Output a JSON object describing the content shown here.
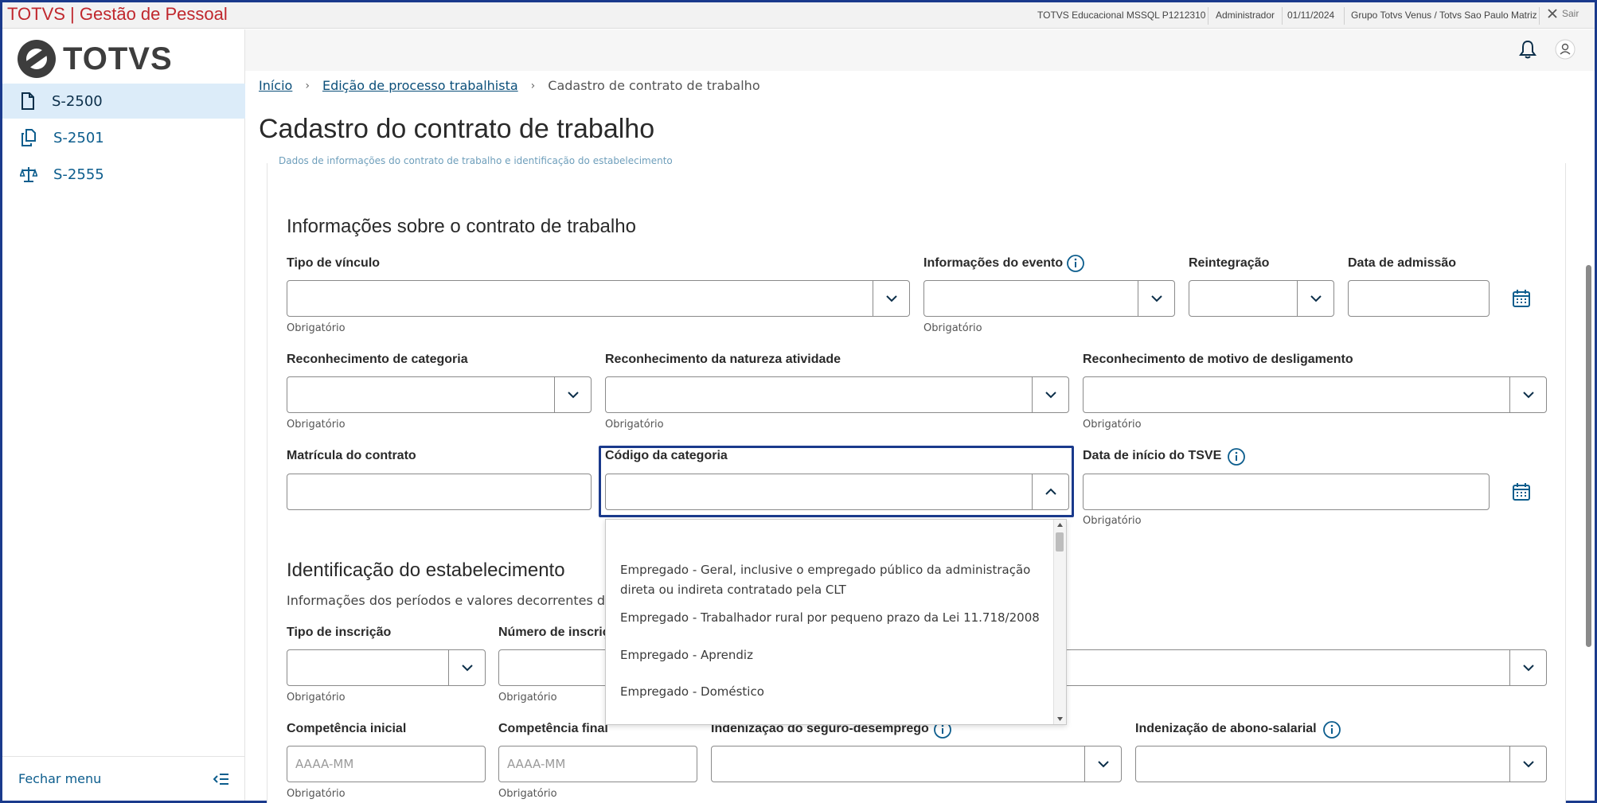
{
  "titlebar": {
    "app_title": "TOTVS | Gestão de Pessoal",
    "environment": "TOTVS Educacional MSSQL P1212310",
    "user": "Administrador",
    "date": "01/11/2024",
    "company": "Grupo Totvs Venus / Totvs Sao Paulo Matriz",
    "exit_label": "Sair"
  },
  "sidebar": {
    "logo_text": "TOTVS",
    "items": [
      {
        "label": "S-2500",
        "icon": "file-icon"
      },
      {
        "label": "S-2501",
        "icon": "copy-files-icon"
      },
      {
        "label": "S-2555",
        "icon": "scale-icon"
      }
    ],
    "close_menu": "Fechar menu"
  },
  "breadcrumb": {
    "home": "Início",
    "parent": "Edição de processo trabalhista",
    "current": "Cadastro de contrato de trabalho"
  },
  "page_title": "Cadastro do contrato de trabalho",
  "cut_text": "Dados de informações do contrato de trabalho e identificação do estabelecimento",
  "contract_section": {
    "title": "Informações sobre o contrato de trabalho",
    "tipo_vinculo": {
      "label": "Tipo de vínculo",
      "helper": "Obrigatório",
      "value": ""
    },
    "info_evento": {
      "label": "Informações do evento",
      "helper": "Obrigatório",
      "value": ""
    },
    "reintegracao": {
      "label": "Reintegração",
      "value": ""
    },
    "data_admissao": {
      "label": "Data de admissão",
      "value": ""
    },
    "rec_categoria": {
      "label": "Reconhecimento de categoria",
      "helper": "Obrigatório",
      "value": ""
    },
    "rec_natureza": {
      "label": "Reconhecimento da natureza atividade",
      "helper": "Obrigatório",
      "value": ""
    },
    "rec_motivo": {
      "label": "Reconhecimento de motivo de desligamento",
      "helper": "Obrigatório",
      "value": ""
    },
    "matricula": {
      "label": "Matrícula do contrato",
      "value": ""
    },
    "codigo_categoria": {
      "label": "Código da categoria",
      "value": ""
    },
    "data_tsve": {
      "label": "Data de início do TSVE",
      "helper": "Obrigatório",
      "value": ""
    }
  },
  "dropdown": {
    "options": [
      "Empregado - Geral, inclusive o empregado público da administração direta ou indireta contratado pela CLT",
      "Empregado - Trabalhador rural por pequeno prazo da Lei 11.718/2008",
      "Empregado - Aprendiz",
      "Empregado - Doméstico"
    ]
  },
  "establishment_section": {
    "title": "Identificação do estabelecimento",
    "subtitle": "Informações dos períodos e valores decorrentes de pro",
    "tipo_inscricao": {
      "label": "Tipo de inscrição",
      "helper": "Obrigatório"
    },
    "numero_inscricao": {
      "label": "Número de inscriç",
      "helper": "Obrigatório"
    },
    "competencia_inicial": {
      "label": "Competência inicial",
      "placeholder": "AAAA-MM",
      "helper": "Obrigatório"
    },
    "competencia_final": {
      "label": "Competência final",
      "placeholder": "AAAA-MM",
      "helper": "Obrigatório"
    },
    "seguro_desemprego": {
      "label": "Indenização do seguro-desemprego"
    },
    "abono_salarial": {
      "label": "Indenização de abono-salarial"
    }
  },
  "colors": {
    "brand_red": "#c0272d",
    "link_blue": "#0c5d8d",
    "focus_border": "#1a3a8c",
    "active_item_bg": "#dcecf9"
  }
}
